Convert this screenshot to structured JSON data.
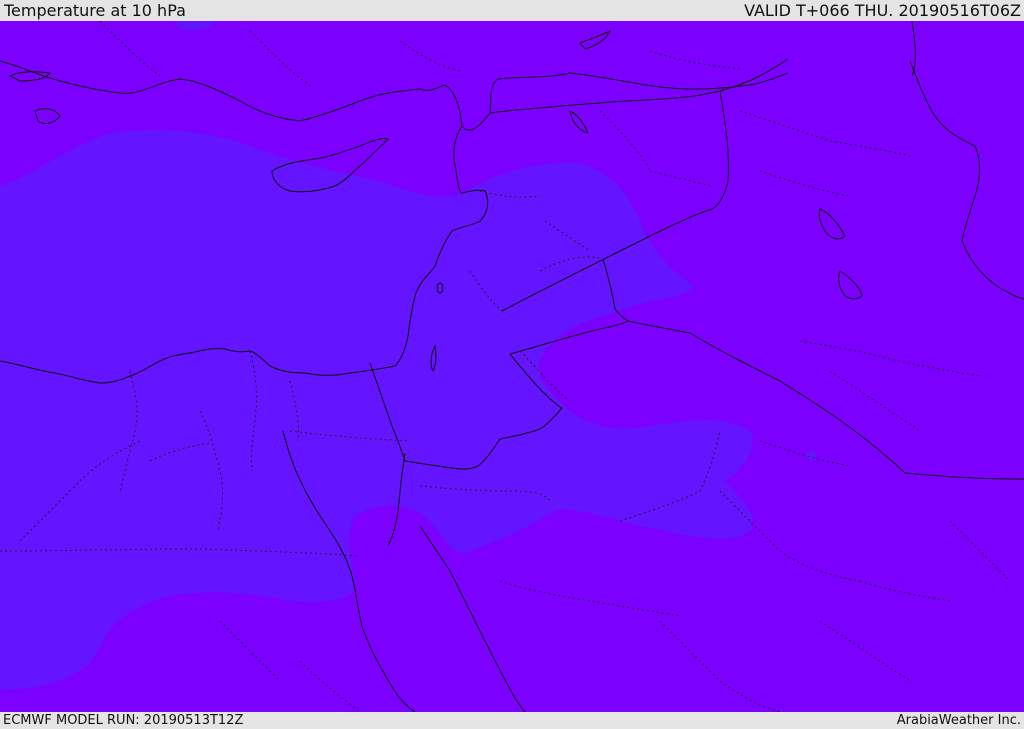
{
  "header": {
    "title": "Temperature at 10 hPa",
    "valid_time": "VALID T+066 THU. 20190516T06Z"
  },
  "footer": {
    "model_run": "ECMWF MODEL RUN: 20190513T12Z",
    "provider": "ArabiaWeather Inc."
  },
  "colors": {
    "background_field": "#7c00ff",
    "cooler_field": "#6414ff",
    "coastline": "#111111",
    "border": "#111111",
    "bars": "#e4e4e4"
  },
  "map": {
    "variable": "Temperature",
    "level": "10 hPa"
  }
}
